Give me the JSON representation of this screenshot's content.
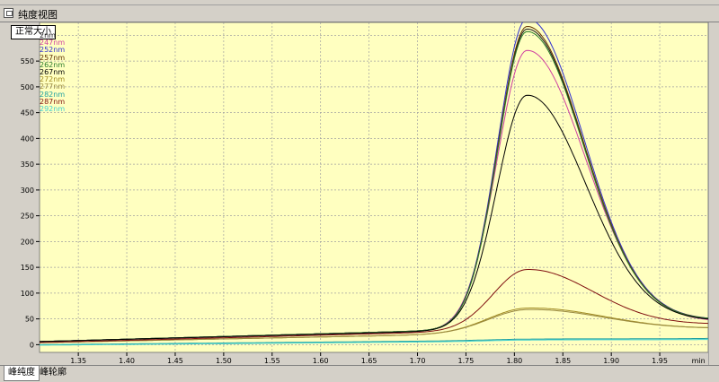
{
  "window": {
    "title": "纯度视图"
  },
  "toolbar": {
    "normal_size_label": "正常大小"
  },
  "tabs": [
    {
      "label": "峰纯度"
    },
    {
      "label": "峰轮廓"
    }
  ],
  "chart_data": {
    "type": "line",
    "xlim": [
      1.31,
      2.0
    ],
    "ylim": [
      -15,
      625
    ],
    "x_ticks": [
      1.35,
      1.4,
      1.45,
      1.5,
      1.55,
      1.6,
      1.65,
      1.7,
      1.75,
      1.8,
      1.85,
      1.9,
      1.95
    ],
    "x_tick_labels": [
      "1.35",
      "1.40",
      "1.45",
      "1.50",
      "1.55",
      "1.60",
      "1.65",
      "1.70",
      "1.75",
      "1.80",
      "1.85",
      "1.90",
      "1.95"
    ],
    "x_unit_label": "min",
    "y_ticks": [
      0,
      50,
      100,
      150,
      200,
      250,
      300,
      350,
      400,
      450,
      500,
      550,
      600
    ],
    "grid": true,
    "background": "#ffffc0",
    "legend_position": "top-left",
    "series": [
      {
        "name": "2nm",
        "color": "#1a1a1a",
        "baseline_start": 6,
        "baseline_end": 42,
        "peak": 580,
        "width": 0.03,
        "tail": 85
      },
      {
        "name": "247nm",
        "color": "#d040a0",
        "baseline_start": 6,
        "baseline_end": 40,
        "peak": 540,
        "width": 0.031,
        "tail": 70
      },
      {
        "name": "252nm",
        "color": "#3030d0",
        "baseline_start": 6,
        "baseline_end": 42,
        "peak": 600,
        "width": 0.03,
        "tail": 90
      },
      {
        "name": "257nm",
        "color": "#603000",
        "baseline_start": 6,
        "baseline_end": 42,
        "peak": 585,
        "width": 0.03,
        "tail": 88
      },
      {
        "name": "262nm",
        "color": "#2a7a2a",
        "baseline_start": 6,
        "baseline_end": 42,
        "peak": 575,
        "width": 0.03,
        "tail": 85
      },
      {
        "name": "267nm",
        "color": "#000000",
        "baseline_start": 6,
        "baseline_end": 40,
        "peak": 453,
        "width": 0.031,
        "tail": 90
      },
      {
        "name": "272nm",
        "color": "#a08a20",
        "baseline_start": 4,
        "baseline_end": 30,
        "peak": 48,
        "width": 0.04,
        "tail": 10
      },
      {
        "name": "277nm",
        "color": "#9a8a40",
        "baseline_start": 4,
        "baseline_end": 30,
        "peak": 45,
        "width": 0.04,
        "tail": 10
      },
      {
        "name": "282nm",
        "color": "#20a0a0",
        "baseline_start": 0,
        "baseline_end": 12,
        "peak": 2,
        "width": 0.04,
        "tail": 0
      },
      {
        "name": "287nm",
        "color": "#801010",
        "baseline_start": 4,
        "baseline_end": 38,
        "peak": 117,
        "width": 0.035,
        "tail": 15
      },
      {
        "name": "292nm",
        "color": "#40d0d0",
        "baseline_start": -1,
        "baseline_end": 10,
        "peak": 2,
        "width": 0.04,
        "tail": 0
      }
    ],
    "peak_x": 1.813
  }
}
